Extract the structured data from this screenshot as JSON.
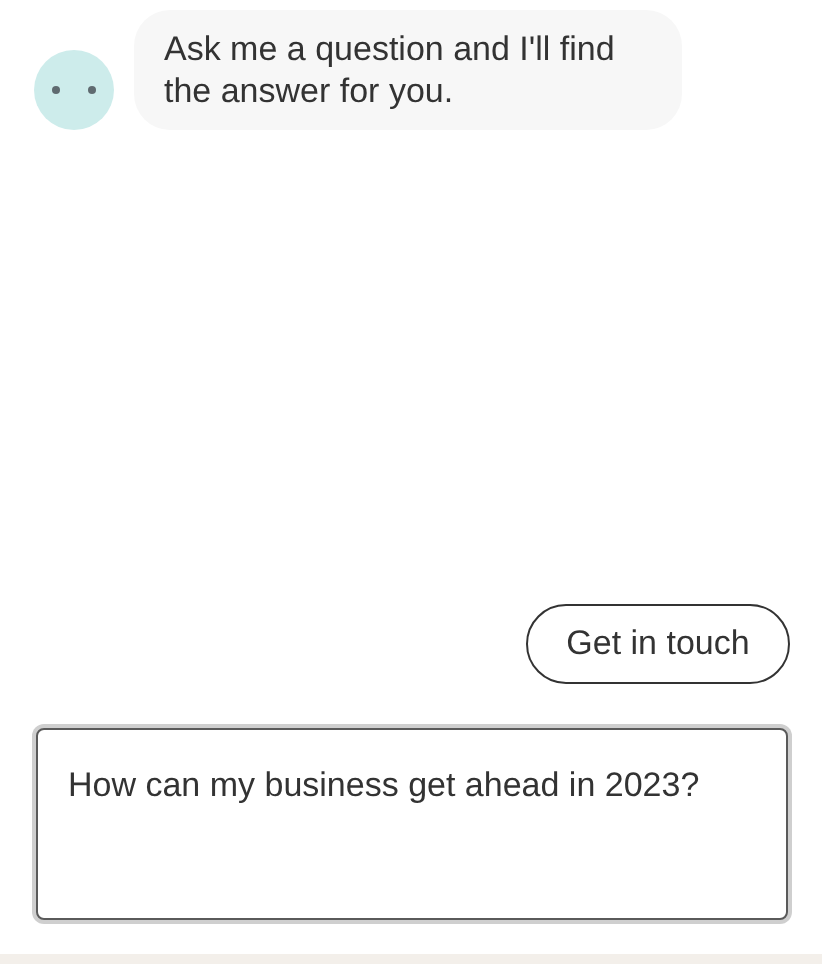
{
  "messages": [
    {
      "kind": "bot",
      "text": "Ask me a question and I'll find the answer for you."
    }
  ],
  "actions": [
    {
      "label": "Get in touch"
    }
  ],
  "input": {
    "value": "How can my business get ahead in 2023?"
  }
}
